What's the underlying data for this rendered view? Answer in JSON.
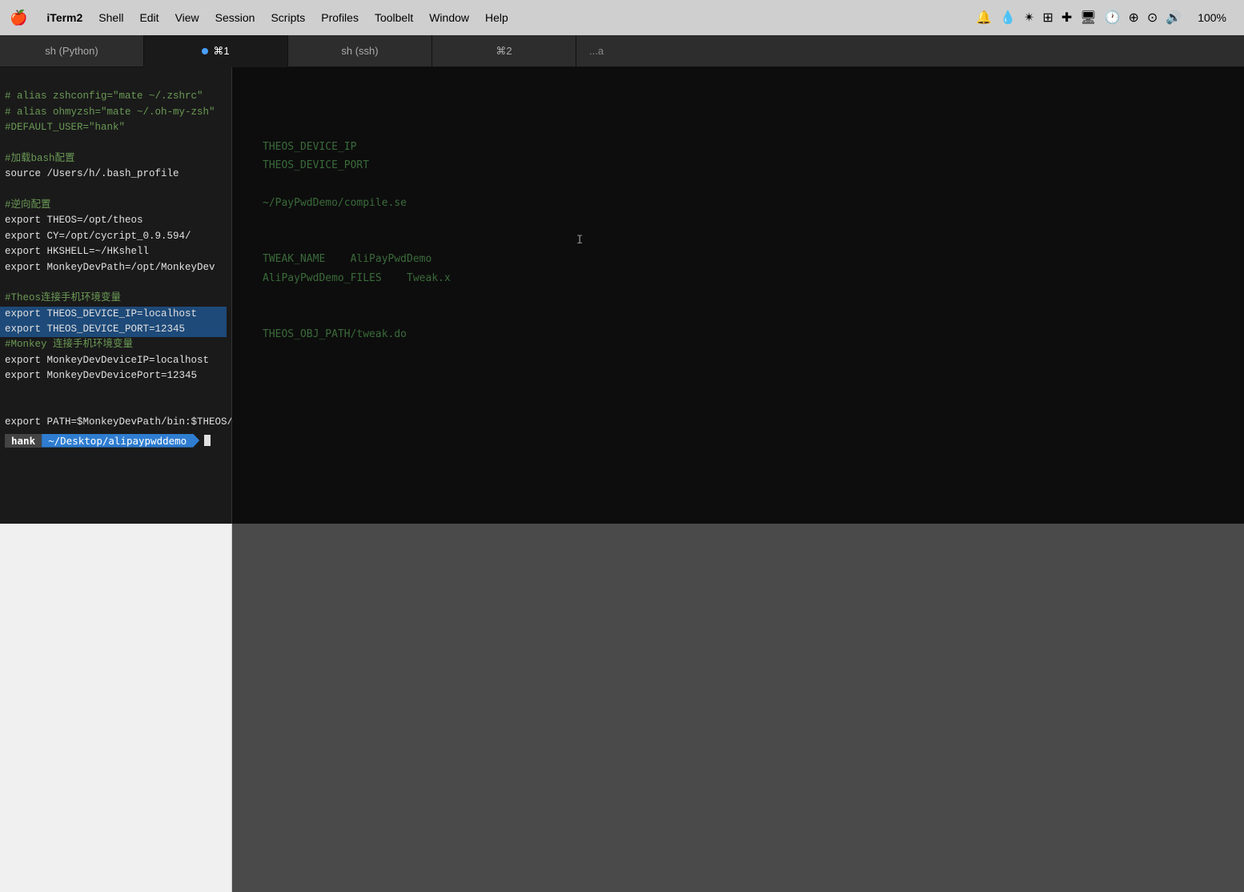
{
  "menubar": {
    "apple": "🍎",
    "items": [
      {
        "id": "iterm2",
        "label": "iTerm2",
        "bold": true
      },
      {
        "id": "shell",
        "label": "Shell"
      },
      {
        "id": "edit",
        "label": "Edit"
      },
      {
        "id": "view",
        "label": "View"
      },
      {
        "id": "session",
        "label": "Session"
      },
      {
        "id": "scripts",
        "label": "Scripts"
      },
      {
        "id": "profiles",
        "label": "Profiles"
      },
      {
        "id": "toolbelt",
        "label": "Toolbelt"
      },
      {
        "id": "window",
        "label": "Window"
      },
      {
        "id": "help",
        "label": "Help"
      }
    ],
    "right": {
      "battery": "100%",
      "wifi": "⊕",
      "time": "⊙"
    }
  },
  "tabs": [
    {
      "id": "tab1",
      "label": "sh (Python)",
      "active": false,
      "has_dot": false,
      "cmd": ""
    },
    {
      "id": "tab2",
      "label": "⌘1",
      "active": true,
      "has_dot": true,
      "cmd": ""
    },
    {
      "id": "tab3",
      "label": "sh (ssh)",
      "active": false,
      "has_dot": false,
      "cmd": ""
    },
    {
      "id": "tab4",
      "label": "⌘2",
      "active": false,
      "has_dot": false,
      "cmd": ""
    },
    {
      "id": "tab5",
      "label": "...a",
      "active": false,
      "has_dot": false,
      "cmd": ""
    }
  ],
  "terminal": {
    "lines": [
      {
        "text": "# alias zshconfig=\"mate ~/.zshrc\"",
        "type": "comment"
      },
      {
        "text": "# alias ohmyzsh=\"mate ~/.oh-my-zsh\"",
        "type": "comment"
      },
      {
        "text": "#DEFAULT_USER=\"hank\"",
        "type": "comment"
      },
      {
        "text": "",
        "type": "normal"
      },
      {
        "text": "#加载bash配置",
        "type": "comment"
      },
      {
        "text": "source /Users/h/.bash_profile",
        "type": "normal"
      },
      {
        "text": "",
        "type": "normal"
      },
      {
        "text": "#逆向配置",
        "type": "comment"
      },
      {
        "text": "export THEOS=/opt/theos",
        "type": "normal"
      },
      {
        "text": "export CY=/opt/cycript_0.9.594/",
        "type": "normal"
      },
      {
        "text": "export HKSHELL=~/HKshell",
        "type": "normal"
      },
      {
        "text": "export MonkeyDevPath=/opt/MonkeyDev",
        "type": "normal"
      },
      {
        "text": "",
        "type": "normal"
      },
      {
        "text": "#Theos连接手机环境变量",
        "type": "comment"
      },
      {
        "text": "export THEOS_DEVICE_IP=localhost",
        "type": "highlight"
      },
      {
        "text": "export THEOS_DEVICE_PORT=12345",
        "type": "highlight"
      },
      {
        "text": "#Monkey 连接手机环境变量",
        "type": "comment"
      },
      {
        "text": "export MonkeyDevDeviceIP=localhost",
        "type": "normal"
      },
      {
        "text": "export MonkeyDevDevicePort=12345",
        "type": "normal"
      },
      {
        "text": "",
        "type": "normal"
      },
      {
        "text": "",
        "type": "normal"
      },
      {
        "text": "export PATH=$MonkeyDevPath/bin:$THEOS/bin/:$CY:$HKSHELL:$PATH",
        "type": "normal"
      }
    ],
    "prompt_user": "hank",
    "prompt_path": "~/Desktop/alipaypwddemo",
    "cursor": "_"
  },
  "faded_right": [
    "THEOS_DEVICE_IP",
    "THEOS_DEVICE_PORT",
    "",
    "~/PayPwdDemo/compile.se",
    "",
    "TWEAK_NAME    AliPayPwdDemo",
    "AliPayPwdDemo_FILES    Tweak.x",
    "",
    "THEOS_OBJ_PATH/tweak.do"
  ]
}
